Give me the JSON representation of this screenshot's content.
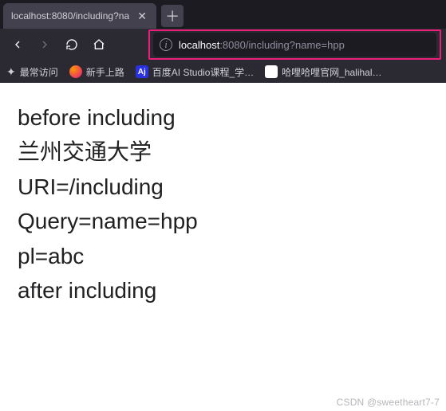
{
  "tab": {
    "title": "localhost:8080/including?na"
  },
  "url": {
    "host": "localhost",
    "rest": ":8080/including?name=hpp"
  },
  "bookmarks": {
    "most_visited": "最常访问",
    "firefox": "新手上路",
    "baidu": "百度AI Studio课程_学…",
    "hali": "哈哩哈哩官网_halihal…"
  },
  "page": {
    "line1": "before including",
    "line2": "兰州交通大学",
    "line3": "URI=/including",
    "line4": "Query=name=hpp",
    "line5": "pl=abc",
    "line6": "after including"
  },
  "watermark": "CSDN @sweetheart7-7"
}
